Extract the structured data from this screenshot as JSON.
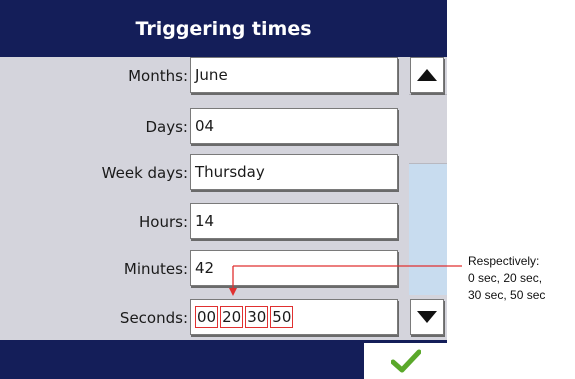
{
  "title": "Triggering times",
  "fields": [
    {
      "label": "Months:",
      "value": "June"
    },
    {
      "label": "Days:",
      "value": "04"
    },
    {
      "label": "Week days:",
      "value": "Thursday"
    },
    {
      "label": "Hours:",
      "value": "14"
    },
    {
      "label": "Minutes:",
      "value": "42"
    }
  ],
  "seconds": {
    "label": "Seconds:",
    "values": [
      "00",
      "20",
      "30",
      "50"
    ]
  },
  "annotation": {
    "line1": "Respectively:",
    "line2": "0 sec, 20 sec,",
    "line3": "30 sec, 50 sec"
  },
  "icons": {
    "scroll_up": "up-arrow-icon",
    "scroll_down": "down-arrow-icon",
    "confirm": "checkmark-icon"
  },
  "colors": {
    "header": "#141e59",
    "highlight": "#e03030",
    "confirm": "#5aa82a",
    "scroll_fill": "#c8dcef"
  }
}
